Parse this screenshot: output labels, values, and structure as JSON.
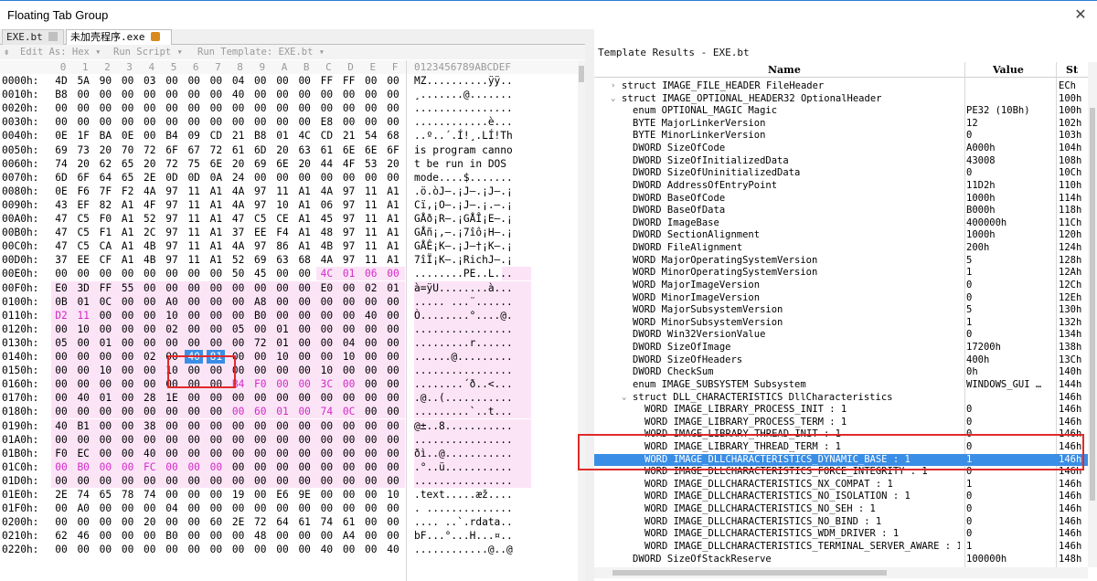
{
  "window": {
    "title": "Floating Tab Group",
    "close": "✕"
  },
  "tabs": [
    {
      "label": "EXE.bt"
    },
    {
      "label": "未加壳程序.exe"
    }
  ],
  "toolbar": {
    "edit_as": "Edit As: Hex",
    "run_script": "Run Script",
    "run_template": "Run Template: EXE.bt"
  },
  "hex_header": {
    "cols": [
      "0",
      "1",
      "2",
      "3",
      "4",
      "5",
      "6",
      "7",
      "8",
      "9",
      "A",
      "B",
      "C",
      "D",
      "E",
      "F"
    ],
    "ascii": "0123456789ABCDEF"
  },
  "hex_rows": [
    {
      "addr": "0000h:",
      "bytes": [
        "4D",
        "5A",
        "90",
        "00",
        "03",
        "00",
        "00",
        "00",
        "04",
        "00",
        "00",
        "00",
        "FF",
        "FF",
        "00",
        "00"
      ],
      "ascii": "MZ..........ÿÿ.."
    },
    {
      "addr": "0010h:",
      "bytes": [
        "B8",
        "00",
        "00",
        "00",
        "00",
        "00",
        "00",
        "00",
        "40",
        "00",
        "00",
        "00",
        "00",
        "00",
        "00",
        "00"
      ],
      "ascii": "¸.......@......."
    },
    {
      "addr": "0020h:",
      "bytes": [
        "00",
        "00",
        "00",
        "00",
        "00",
        "00",
        "00",
        "00",
        "00",
        "00",
        "00",
        "00",
        "00",
        "00",
        "00",
        "00"
      ],
      "ascii": "................"
    },
    {
      "addr": "0030h:",
      "bytes": [
        "00",
        "00",
        "00",
        "00",
        "00",
        "00",
        "00",
        "00",
        "00",
        "00",
        "00",
        "00",
        "E8",
        "00",
        "00",
        "00"
      ],
      "ascii": "............è..."
    },
    {
      "addr": "0040h:",
      "bytes": [
        "0E",
        "1F",
        "BA",
        "0E",
        "00",
        "B4",
        "09",
        "CD",
        "21",
        "B8",
        "01",
        "4C",
        "CD",
        "21",
        "54",
        "68"
      ],
      "ascii": "..º..´.Í!¸.LÍ!Th"
    },
    {
      "addr": "0050h:",
      "bytes": [
        "69",
        "73",
        "20",
        "70",
        "72",
        "6F",
        "67",
        "72",
        "61",
        "6D",
        "20",
        "63",
        "61",
        "6E",
        "6E",
        "6F"
      ],
      "ascii": "is program canno"
    },
    {
      "addr": "0060h:",
      "bytes": [
        "74",
        "20",
        "62",
        "65",
        "20",
        "72",
        "75",
        "6E",
        "20",
        "69",
        "6E",
        "20",
        "44",
        "4F",
        "53",
        "20"
      ],
      "ascii": "t be run in DOS "
    },
    {
      "addr": "0070h:",
      "bytes": [
        "6D",
        "6F",
        "64",
        "65",
        "2E",
        "0D",
        "0D",
        "0A",
        "24",
        "00",
        "00",
        "00",
        "00",
        "00",
        "00",
        "00"
      ],
      "ascii": "mode....$......."
    },
    {
      "addr": "0080h:",
      "bytes": [
        "0E",
        "F6",
        "7F",
        "F2",
        "4A",
        "97",
        "11",
        "A1",
        "4A",
        "97",
        "11",
        "A1",
        "4A",
        "97",
        "11",
        "A1"
      ],
      "ascii": ".ö.òJ—.¡J—.¡J—.¡"
    },
    {
      "addr": "0090h:",
      "bytes": [
        "43",
        "EF",
        "82",
        "A1",
        "4F",
        "97",
        "11",
        "A1",
        "4A",
        "97",
        "10",
        "A1",
        "06",
        "97",
        "11",
        "A1"
      ],
      "ascii": "Cï‚¡O—.¡J—.¡.—.¡"
    },
    {
      "addr": "00A0h:",
      "bytes": [
        "47",
        "C5",
        "F0",
        "A1",
        "52",
        "97",
        "11",
        "A1",
        "47",
        "C5",
        "CE",
        "A1",
        "45",
        "97",
        "11",
        "A1"
      ],
      "ascii": "GÅð¡R—.¡GÅÎ¡E—.¡"
    },
    {
      "addr": "00B0h:",
      "bytes": [
        "47",
        "C5",
        "F1",
        "A1",
        "2C",
        "97",
        "11",
        "A1",
        "37",
        "EE",
        "F4",
        "A1",
        "48",
        "97",
        "11",
        "A1"
      ],
      "ascii": "GÅñ¡,—.¡7îô¡H—.¡"
    },
    {
      "addr": "00C0h:",
      "bytes": [
        "47",
        "C5",
        "CA",
        "A1",
        "4B",
        "97",
        "11",
        "A1",
        "4A",
        "97",
        "86",
        "A1",
        "4B",
        "97",
        "11",
        "A1"
      ],
      "ascii": "GÅÊ¡K—.¡J—†¡K—.¡"
    },
    {
      "addr": "00D0h:",
      "bytes": [
        "37",
        "EE",
        "CF",
        "A1",
        "4B",
        "97",
        "11",
        "A1",
        "52",
        "69",
        "63",
        "68",
        "4A",
        "97",
        "11",
        "A1"
      ],
      "ascii": "7îÏ¡K—.¡RichJ—.¡"
    },
    {
      "addr": "00E0h:",
      "bytes": [
        "00",
        "00",
        "00",
        "00",
        "00",
        "00",
        "00",
        "00",
        "50",
        "45",
        "00",
        "00",
        "4C",
        "01",
        "06",
        "00"
      ],
      "ascii": "........PE..L..."
    },
    {
      "addr": "00F0h:",
      "bytes": [
        "E0",
        "3D",
        "FF",
        "55",
        "00",
        "00",
        "00",
        "00",
        "00",
        "00",
        "00",
        "00",
        "E0",
        "00",
        "02",
        "01"
      ],
      "ascii": "à=ÿU........à..."
    },
    {
      "addr": "0100h:",
      "bytes": [
        "0B",
        "01",
        "0C",
        "00",
        "00",
        "A0",
        "00",
        "00",
        "00",
        "A8",
        "00",
        "00",
        "00",
        "00",
        "00",
        "00"
      ],
      "ascii": "..... ...¨......"
    },
    {
      "addr": "0110h:",
      "bytes": [
        "D2",
        "11",
        "00",
        "00",
        "00",
        "10",
        "00",
        "00",
        "00",
        "B0",
        "00",
        "00",
        "00",
        "00",
        "40",
        "00"
      ],
      "ascii": "Ò........°....@."
    },
    {
      "addr": "0120h:",
      "bytes": [
        "00",
        "10",
        "00",
        "00",
        "00",
        "02",
        "00",
        "00",
        "05",
        "00",
        "01",
        "00",
        "00",
        "00",
        "00",
        "00"
      ],
      "ascii": "................"
    },
    {
      "addr": "0130h:",
      "bytes": [
        "05",
        "00",
        "01",
        "00",
        "00",
        "00",
        "00",
        "00",
        "00",
        "72",
        "01",
        "00",
        "00",
        "04",
        "00",
        "00"
      ],
      "ascii": ".........r......"
    },
    {
      "addr": "0140h:",
      "bytes": [
        "00",
        "00",
        "00",
        "00",
        "02",
        "00",
        "40",
        "81",
        "00",
        "00",
        "10",
        "00",
        "00",
        "10",
        "00",
        "00"
      ],
      "ascii": "......@........."
    },
    {
      "addr": "0150h:",
      "bytes": [
        "00",
        "00",
        "10",
        "00",
        "00",
        "10",
        "00",
        "00",
        "00",
        "00",
        "00",
        "00",
        "10",
        "00",
        "00",
        "00"
      ],
      "ascii": "................"
    },
    {
      "addr": "0160h:",
      "bytes": [
        "00",
        "00",
        "00",
        "00",
        "00",
        "00",
        "00",
        "00",
        "B4",
        "F0",
        "00",
        "00",
        "3C",
        "00",
        "00",
        "00"
      ],
      "ascii": "........´ð..<..."
    },
    {
      "addr": "0170h:",
      "bytes": [
        "00",
        "40",
        "01",
        "00",
        "28",
        "1E",
        "00",
        "00",
        "00",
        "00",
        "00",
        "00",
        "00",
        "00",
        "00",
        "00"
      ],
      "ascii": ".@..(..........."
    },
    {
      "addr": "0180h:",
      "bytes": [
        "00",
        "00",
        "00",
        "00",
        "00",
        "00",
        "00",
        "00",
        "00",
        "60",
        "01",
        "00",
        "74",
        "0C",
        "00",
        "00"
      ],
      "ascii": ".........`..t..."
    },
    {
      "addr": "0190h:",
      "bytes": [
        "40",
        "B1",
        "00",
        "00",
        "38",
        "00",
        "00",
        "00",
        "00",
        "00",
        "00",
        "00",
        "00",
        "00",
        "00",
        "00"
      ],
      "ascii": "@±..8..........."
    },
    {
      "addr": "01A0h:",
      "bytes": [
        "00",
        "00",
        "00",
        "00",
        "00",
        "00",
        "00",
        "00",
        "00",
        "00",
        "00",
        "00",
        "00",
        "00",
        "00",
        "00"
      ],
      "ascii": "................"
    },
    {
      "addr": "01B0h:",
      "bytes": [
        "F0",
        "EC",
        "00",
        "00",
        "40",
        "00",
        "00",
        "00",
        "00",
        "00",
        "00",
        "00",
        "00",
        "00",
        "00",
        "00"
      ],
      "ascii": "ðì..@..........."
    },
    {
      "addr": "01C0h:",
      "bytes": [
        "00",
        "B0",
        "00",
        "00",
        "FC",
        "00",
        "00",
        "00",
        "00",
        "00",
        "00",
        "00",
        "00",
        "00",
        "00",
        "00"
      ],
      "ascii": ".°..ü..........."
    },
    {
      "addr": "01D0h:",
      "bytes": [
        "00",
        "00",
        "00",
        "00",
        "00",
        "00",
        "00",
        "00",
        "00",
        "00",
        "00",
        "00",
        "00",
        "00",
        "00",
        "00"
      ],
      "ascii": "................"
    },
    {
      "addr": "01E0h:",
      "bytes": [
        "2E",
        "74",
        "65",
        "78",
        "74",
        "00",
        "00",
        "00",
        "19",
        "00",
        "E6",
        "9E",
        "00",
        "00",
        "00",
        "10"
      ],
      "ascii": ".text.....æž...."
    },
    {
      "addr": "01F0h:",
      "bytes": [
        "00",
        "A0",
        "00",
        "00",
        "00",
        "04",
        "00",
        "00",
        "00",
        "00",
        "00",
        "00",
        "00",
        "00",
        "00",
        "00"
      ],
      "ascii": ". .............."
    },
    {
      "addr": "0200h:",
      "bytes": [
        "00",
        "00",
        "00",
        "00",
        "20",
        "00",
        "00",
        "60",
        "2E",
        "72",
        "64",
        "61",
        "74",
        "61",
        "00",
        "00"
      ],
      "ascii": ".... ..`.rdata.."
    },
    {
      "addr": "0210h:",
      "bytes": [
        "62",
        "46",
        "00",
        "00",
        "00",
        "B0",
        "00",
        "00",
        "00",
        "48",
        "00",
        "00",
        "00",
        "A4",
        "00",
        "00"
      ],
      "ascii": "bF...°...H...¤.."
    },
    {
      "addr": "0220h:",
      "bytes": [
        "00",
        "00",
        "00",
        "00",
        "00",
        "00",
        "00",
        "00",
        "00",
        "00",
        "00",
        "00",
        "40",
        "00",
        "00",
        "40"
      ],
      "ascii": "............@..@"
    }
  ],
  "template": {
    "title": "Template Results - EXE.bt",
    "headers": {
      "name": "Name",
      "value": "Value",
      "start": "St"
    },
    "rows": [
      {
        "name": "struct IMAGE_FILE_HEADER FileHeader",
        "value": "",
        "start": "ECh",
        "level": 1,
        "arrow": "›"
      },
      {
        "name": "struct IMAGE_OPTIONAL_HEADER32 OptionalHeader",
        "value": "",
        "start": "100h",
        "level": 1,
        "arrow": "⌄"
      },
      {
        "name": "enum OPTIONAL_MAGIC Magic",
        "value": "PE32 (10Bh)",
        "start": "100h",
        "level": 2,
        "arrow": ""
      },
      {
        "name": "BYTE MajorLinkerVersion",
        "value": "12",
        "start": "102h",
        "level": 2,
        "arrow": ""
      },
      {
        "name": "BYTE MinorLinkerVersion",
        "value": "0",
        "start": "103h",
        "level": 2,
        "arrow": ""
      },
      {
        "name": "DWORD SizeOfCode",
        "value": "A000h",
        "start": "104h",
        "level": 2,
        "arrow": ""
      },
      {
        "name": "DWORD SizeOfInitializedData",
        "value": "43008",
        "start": "108h",
        "level": 2,
        "arrow": ""
      },
      {
        "name": "DWORD SizeOfUninitializedData",
        "value": "0",
        "start": "10Ch",
        "level": 2,
        "arrow": ""
      },
      {
        "name": "DWORD AddressOfEntryPoint",
        "value": "11D2h",
        "start": "110h",
        "level": 2,
        "arrow": ""
      },
      {
        "name": "DWORD BaseOfCode",
        "value": "1000h",
        "start": "114h",
        "level": 2,
        "arrow": ""
      },
      {
        "name": "DWORD BaseOfData",
        "value": "B000h",
        "start": "118h",
        "level": 2,
        "arrow": ""
      },
      {
        "name": "DWORD ImageBase",
        "value": "400000h",
        "start": "11Ch",
        "level": 2,
        "arrow": ""
      },
      {
        "name": "DWORD SectionAlignment",
        "value": "1000h",
        "start": "120h",
        "level": 2,
        "arrow": ""
      },
      {
        "name": "DWORD FileAlignment",
        "value": "200h",
        "start": "124h",
        "level": 2,
        "arrow": ""
      },
      {
        "name": "WORD MajorOperatingSystemVersion",
        "value": "5",
        "start": "128h",
        "level": 2,
        "arrow": ""
      },
      {
        "name": "WORD MinorOperatingSystemVersion",
        "value": "1",
        "start": "12Ah",
        "level": 2,
        "arrow": ""
      },
      {
        "name": "WORD MajorImageVersion",
        "value": "0",
        "start": "12Ch",
        "level": 2,
        "arrow": ""
      },
      {
        "name": "WORD MinorImageVersion",
        "value": "0",
        "start": "12Eh",
        "level": 2,
        "arrow": ""
      },
      {
        "name": "WORD MajorSubsystemVersion",
        "value": "5",
        "start": "130h",
        "level": 2,
        "arrow": ""
      },
      {
        "name": "WORD MinorSubsystemVersion",
        "value": "1",
        "start": "132h",
        "level": 2,
        "arrow": ""
      },
      {
        "name": "DWORD Win32VersionValue",
        "value": "0",
        "start": "134h",
        "level": 2,
        "arrow": ""
      },
      {
        "name": "DWORD SizeOfImage",
        "value": "17200h",
        "start": "138h",
        "level": 2,
        "arrow": ""
      },
      {
        "name": "DWORD SizeOfHeaders",
        "value": "400h",
        "start": "13Ch",
        "level": 2,
        "arrow": ""
      },
      {
        "name": "DWORD CheckSum",
        "value": "0h",
        "start": "140h",
        "level": 2,
        "arrow": ""
      },
      {
        "name": "enum IMAGE_SUBSYSTEM Subsystem",
        "value": "WINDOWS_GUI …",
        "start": "144h",
        "level": 2,
        "arrow": ""
      },
      {
        "name": "struct DLL_CHARACTERISTICS DllCharacteristics",
        "value": "",
        "start": "146h",
        "level": 2,
        "arrow": "⌄"
      },
      {
        "name": "WORD IMAGE_LIBRARY_PROCESS_INIT : 1",
        "value": "0",
        "start": "146h",
        "level": 3,
        "arrow": ""
      },
      {
        "name": "WORD IMAGE_LIBRARY_PROCESS_TERM : 1",
        "value": "0",
        "start": "146h",
        "level": 3,
        "arrow": ""
      },
      {
        "name": "WORD IMAGE_LIBRARY_THREAD_INIT : 1",
        "value": "0",
        "start": "146h",
        "level": 3,
        "arrow": ""
      },
      {
        "name": "WORD IMAGE_LIBRARY_THREAD_TERM : 1",
        "value": "0",
        "start": "146h",
        "level": 3,
        "arrow": ""
      },
      {
        "name": "WORD IMAGE_DLLCHARACTERISTICS_DYNAMIC_BASE : 1",
        "value": "1",
        "start": "146h",
        "level": 3,
        "arrow": "",
        "selected": true
      },
      {
        "name": "WORD IMAGE_DLLCHARACTERISTICS_FORCE_INTEGRITY : 1",
        "value": "0",
        "start": "146h",
        "level": 3,
        "arrow": ""
      },
      {
        "name": "WORD IMAGE_DLLCHARACTERISTICS_NX_COMPAT : 1",
        "value": "1",
        "start": "146h",
        "level": 3,
        "arrow": ""
      },
      {
        "name": "WORD IMAGE_DLLCHARACTERISTICS_NO_ISOLATION : 1",
        "value": "0",
        "start": "146h",
        "level": 3,
        "arrow": ""
      },
      {
        "name": "WORD IMAGE_DLLCHARACTERISTICS_NO_SEH : 1",
        "value": "0",
        "start": "146h",
        "level": 3,
        "arrow": ""
      },
      {
        "name": "WORD IMAGE_DLLCHARACTERISTICS_NO_BIND : 1",
        "value": "0",
        "start": "146h",
        "level": 3,
        "arrow": ""
      },
      {
        "name": "WORD IMAGE_DLLCHARACTERISTICS_WDM_DRIVER : 1",
        "value": "0",
        "start": "146h",
        "level": 3,
        "arrow": ""
      },
      {
        "name": "WORD IMAGE_DLLCHARACTERISTICS_TERMINAL_SERVER_AWARE : 1",
        "value": "1",
        "start": "146h",
        "level": 3,
        "arrow": ""
      },
      {
        "name": "DWORD SizeOfStackReserve",
        "value": "100000h",
        "start": "148h",
        "level": 2,
        "arrow": ""
      }
    ]
  },
  "colors": {
    "pink_text": "#d12ac8",
    "pink_bg": "#fce4f7",
    "selection": "#3a8ee6",
    "highlight_box": "#e02a2a"
  }
}
